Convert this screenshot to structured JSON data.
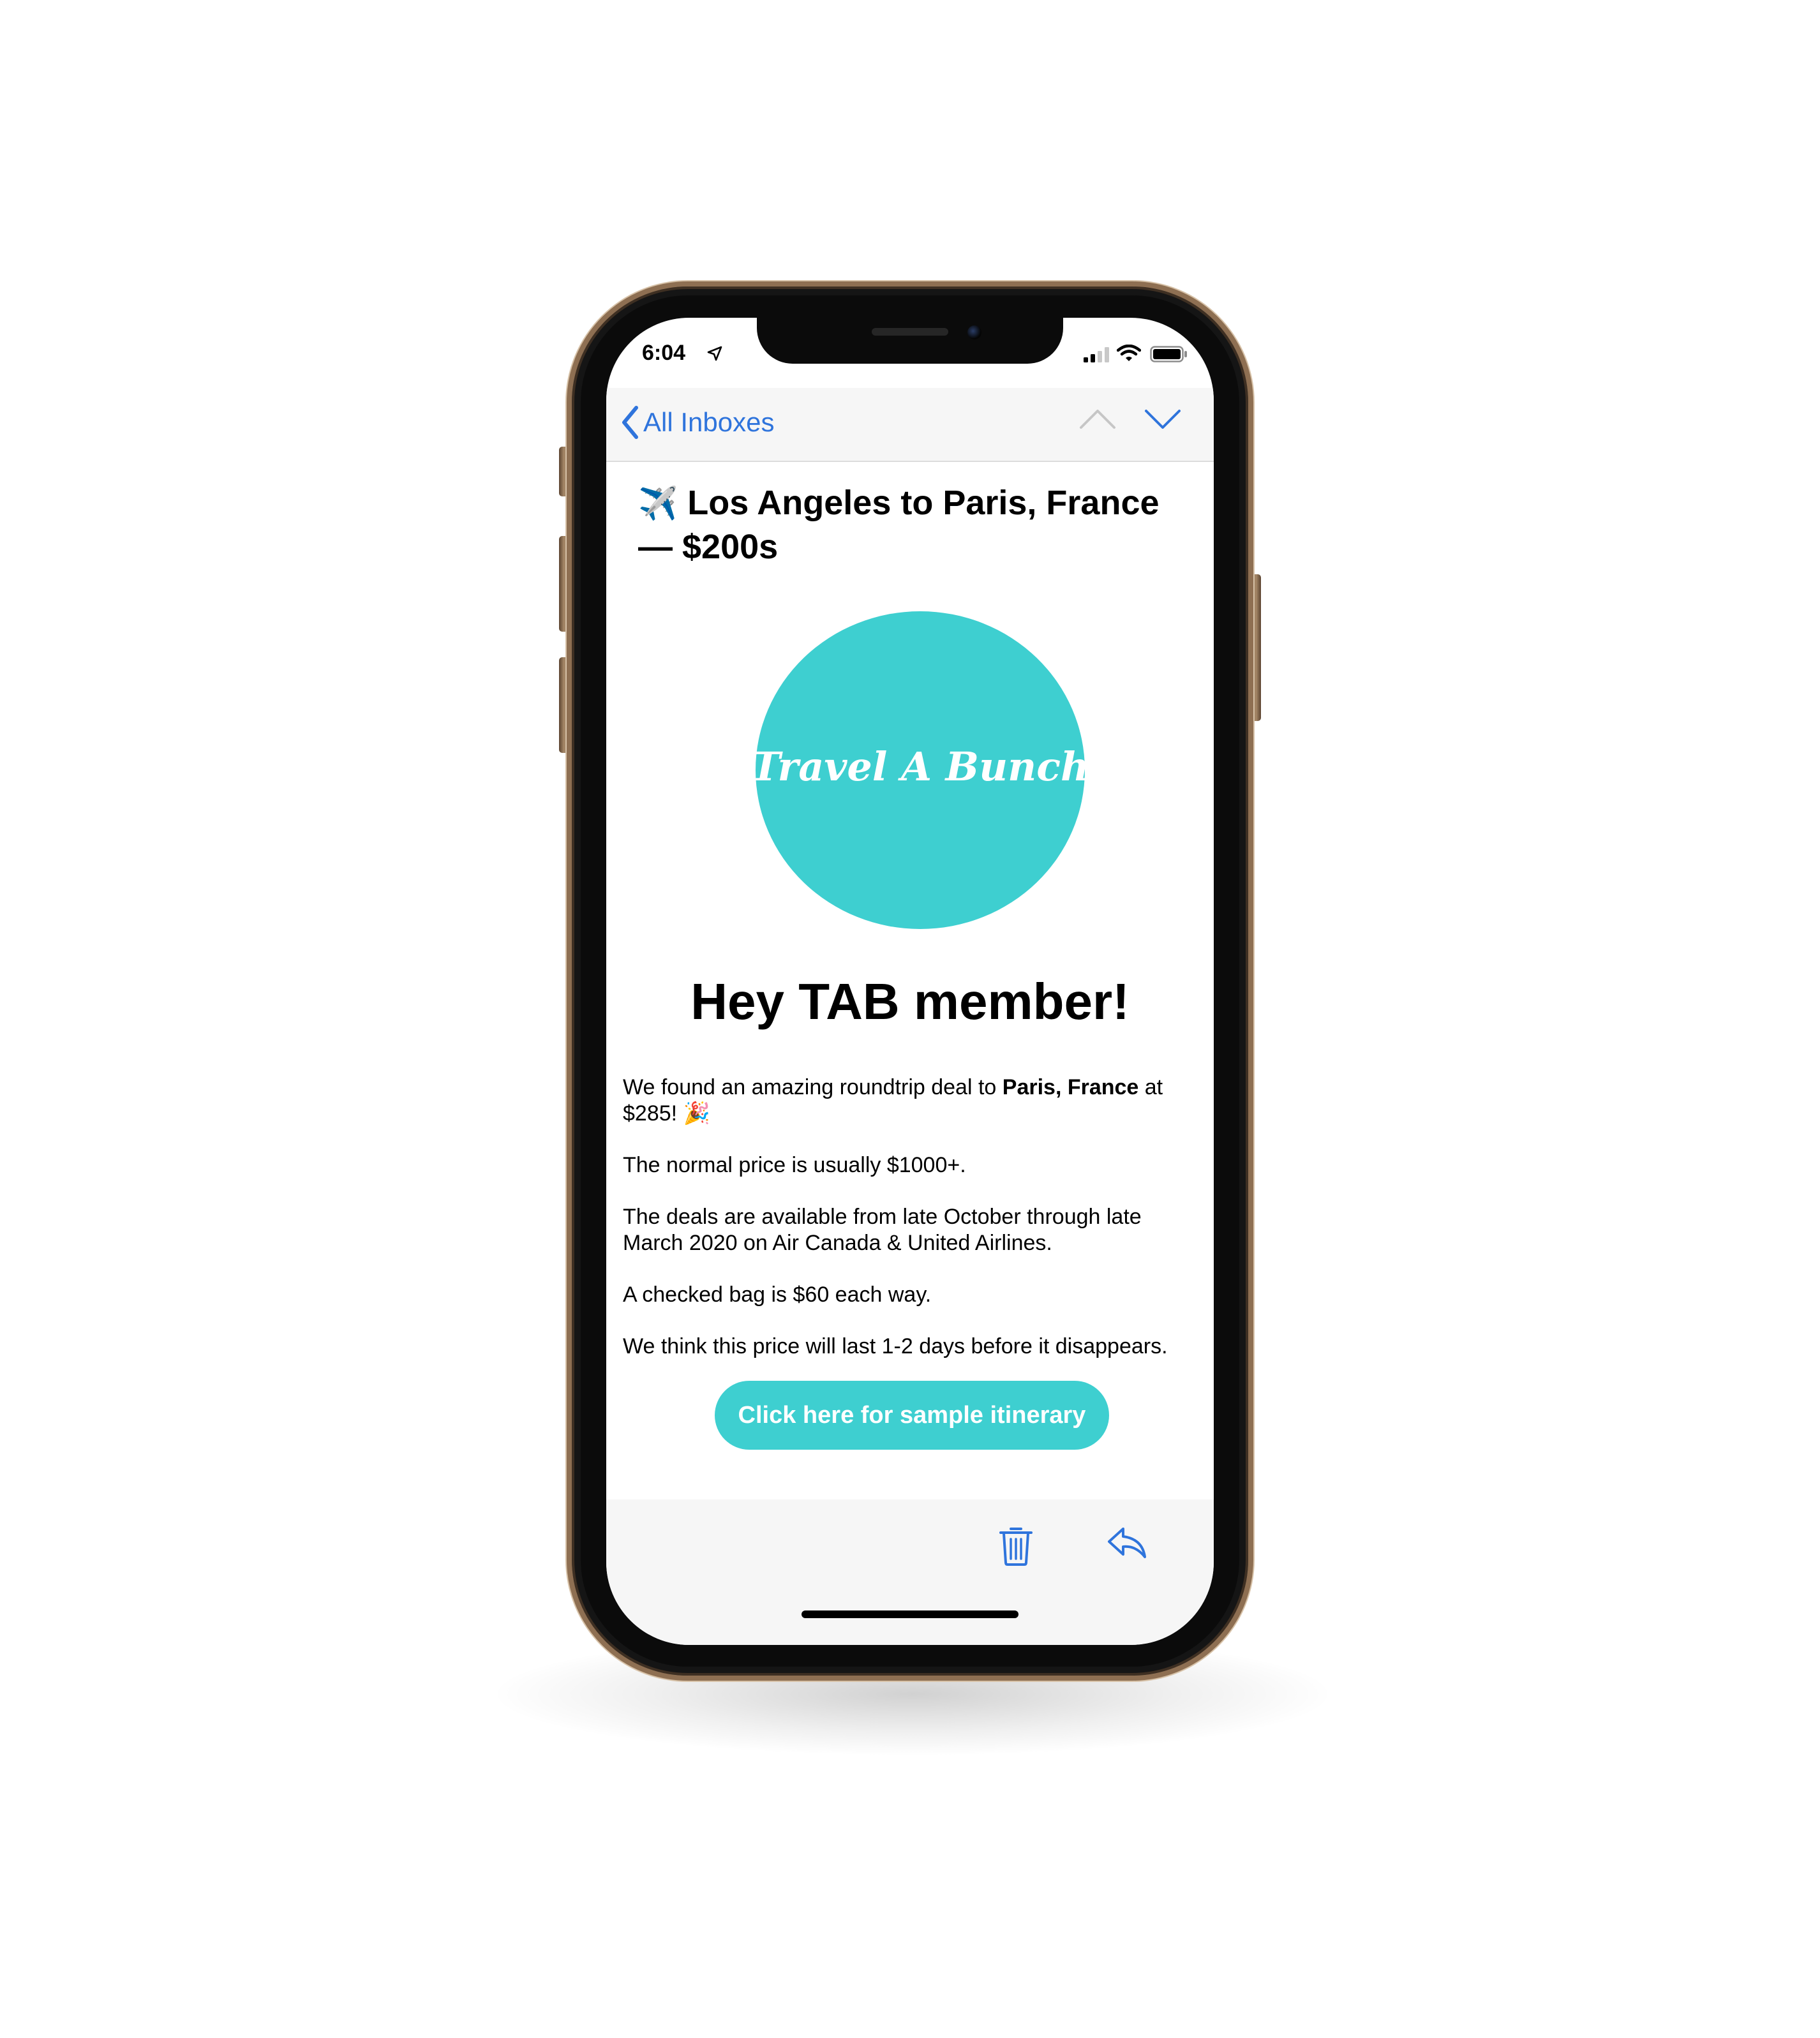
{
  "status_bar": {
    "time": "6:04",
    "icons": [
      "location-arrow-icon",
      "cellular-signal-icon",
      "wifi-icon",
      "battery-icon"
    ]
  },
  "nav": {
    "back_label": "All Inboxes",
    "icons": [
      "chevron-left-icon",
      "chevron-up-icon",
      "chevron-down-icon"
    ]
  },
  "email": {
    "subject_emoji": "✈️",
    "subject": "Los Angeles to Paris, France — $200s",
    "logo_text": "Travel A Bunch",
    "greeting": "Hey TAB member!",
    "paragraph1_before": "We found an amazing roundtrip deal to ",
    "paragraph1_bold": "Paris, France",
    "paragraph1_after": " at $285! 🎉",
    "paragraph2": "The normal price is usually $1000+.",
    "paragraph3": "The deals are available from late October through late March 2020 on Air Canada & United Airlines.",
    "paragraph4": "A checked bag is $60 each way.",
    "paragraph5": "We think this price will last 1-2 days before it disappears.",
    "cta_label": "Click here for sample itinerary"
  },
  "toolbar": {
    "icons": [
      "trash-icon",
      "reply-icon"
    ]
  },
  "colors": {
    "accent_blue": "#2f74dc",
    "brand_teal": "#3ecfd0",
    "frame_gold": "#8e6f52"
  }
}
